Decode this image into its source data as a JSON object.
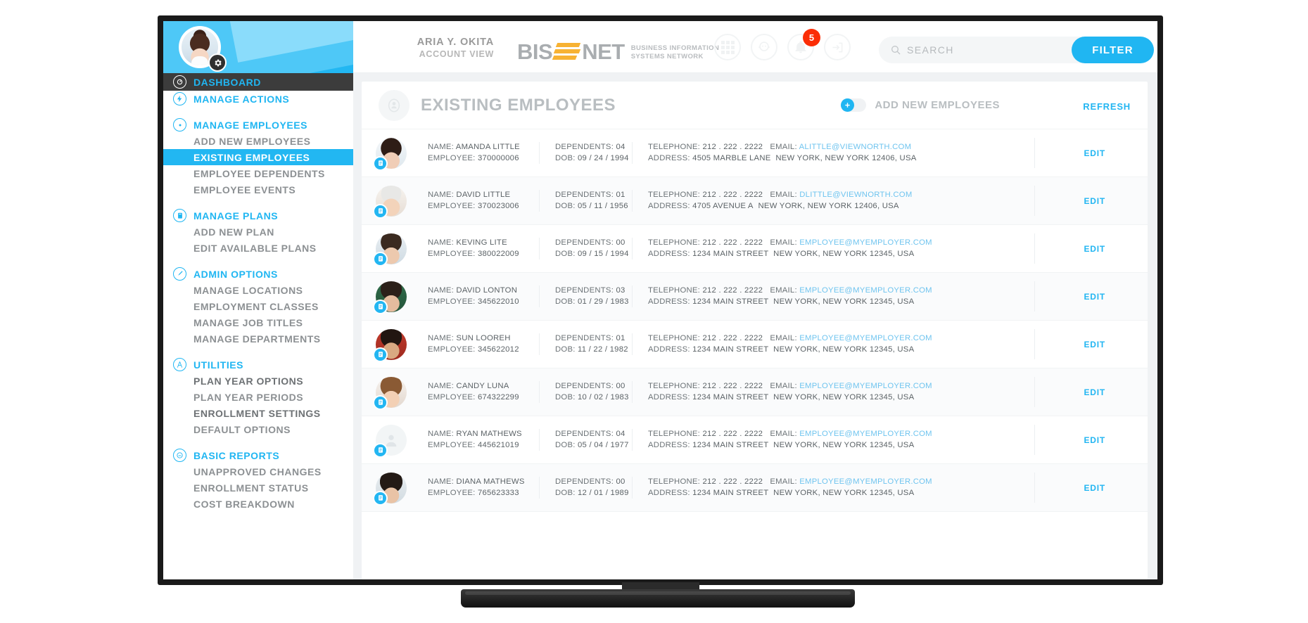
{
  "header": {
    "account_name": "ARIA Y. OKITA",
    "account_sub": "ACCOUNT VIEW",
    "avatar_name": "user-avatar",
    "gear_icon": "gear-icon",
    "logo_part1": "BIS",
    "logo_part2": "NET",
    "logo_sub_line1": "BUSINESS INFORMATION",
    "logo_sub_line2": "SYSTEMS NETWORK",
    "icons": [
      {
        "name": "apps-grid-icon",
        "label": ""
      },
      {
        "name": "support-agent-icon",
        "label": ""
      },
      {
        "name": "notifications-bell-icon",
        "label": ""
      },
      {
        "name": "logout-icon",
        "label": ""
      }
    ],
    "notification_count": "5",
    "search_placeholder": "SEARCH",
    "search_value": "",
    "filter_label": "FILTER",
    "accent_color": "#20b6f2",
    "badge_color": "#fb2d06",
    "logo_mark_color": "#f7b233"
  },
  "sidebar": {
    "items": [
      {
        "label": "DASHBOARD",
        "type": "dashboard",
        "icon": "dashboard-icon"
      },
      {
        "label": "MANAGE ACTIONS",
        "type": "group",
        "icon": "bolt-icon"
      },
      {
        "type": "gap"
      },
      {
        "label": "MANAGE EMPLOYEES",
        "type": "group",
        "icon": "employees-icon"
      },
      {
        "label": "ADD NEW EMPLOYEES",
        "type": "sub"
      },
      {
        "label": "EXISTING EMPLOYEES",
        "type": "sub",
        "active": true
      },
      {
        "label": "EMPLOYEE DEPENDENTS",
        "type": "sub"
      },
      {
        "label": "EMPLOYEE EVENTS",
        "type": "sub"
      },
      {
        "type": "gap"
      },
      {
        "label": "MANAGE PLANS",
        "type": "group",
        "icon": "clipboard-icon"
      },
      {
        "label": "ADD NEW PLAN",
        "type": "sub"
      },
      {
        "label": "EDIT AVAILABLE PLANS",
        "type": "sub"
      },
      {
        "type": "gap"
      },
      {
        "label": "ADMIN OPTIONS",
        "type": "group",
        "icon": "admin-key-icon"
      },
      {
        "label": "MANAGE LOCATIONS",
        "type": "sub"
      },
      {
        "label": "EMPLOYMENT CLASSES",
        "type": "sub"
      },
      {
        "label": "MANAGE JOB TITLES",
        "type": "sub"
      },
      {
        "label": "MANAGE DEPARTMENTS",
        "type": "sub"
      },
      {
        "type": "gap"
      },
      {
        "label": "UTILITIES",
        "type": "group",
        "icon": "utilities-icon"
      },
      {
        "label": "PLAN YEAR OPTIONS",
        "type": "sub",
        "dark": true
      },
      {
        "label": "PLAN YEAR PERIODS",
        "type": "sub"
      },
      {
        "label": "ENROLLMENT SETTINGS",
        "type": "sub",
        "dark": true
      },
      {
        "label": "DEFAULT OPTIONS",
        "type": "sub"
      },
      {
        "type": "gap"
      },
      {
        "label": "BASIC REPORTS",
        "type": "group",
        "icon": "reports-icon"
      },
      {
        "label": "UNAPPROVED CHANGES",
        "type": "sub"
      },
      {
        "label": "ENROLLMENT STATUS",
        "type": "sub"
      },
      {
        "label": "COST BREAKDOWN",
        "type": "sub"
      }
    ]
  },
  "main": {
    "page_icon": "person-circle-icon",
    "page_title": "EXISTING EMPLOYEES",
    "add_toggle_label": "ADD NEW EMPLOYEES",
    "add_toggle_icon": "add-person-icon",
    "refresh_label": "REFRESH",
    "edit_label": "EDIT",
    "labels": {
      "name": "NAME:",
      "employee": "EMPLOYEE:",
      "dependents": "DEPENDENTS:",
      "dob": "DOB:",
      "telephone": "TELEPHONE:",
      "email": "EMAIL:",
      "address": "ADDRESS:"
    },
    "employees": [
      {
        "name": "AMANDA LITTLE",
        "employee_id": "370000006",
        "dependents": "04",
        "dob": "09 / 24 / 1994",
        "telephone": "212 . 222 . 2222",
        "email": "ALITTLE@VIEWNORTH.COM",
        "address_street": "4505 MARBLE LANE",
        "address_city": "NEW YORK, NEW YORK 12406, USA",
        "avatar": "photo-female-dark-hair"
      },
      {
        "name": "DAVID LITTLE",
        "employee_id": "370023006",
        "dependents": "01",
        "dob": "05 / 11 / 1956",
        "telephone": "212 . 222 . 2222",
        "email": "DLITTLE@VIEWNORTH.COM",
        "address_street": "4705 AVENUE A",
        "address_city": "NEW YORK, NEW YORK 12406, USA",
        "avatar": "photo-senior-male"
      },
      {
        "name": "KEVING LITE",
        "employee_id": "380022009",
        "dependents": "00",
        "dob": "09 / 15 / 1994",
        "telephone": "212 . 222 . 2222",
        "email": "EMPLOYEE@MYEMPLOYER.COM",
        "address_street": "1234 MAIN STREET",
        "address_city": "NEW YORK, NEW YORK 12345, USA",
        "avatar": "photo-young-male"
      },
      {
        "name": "DAVID LONTON",
        "employee_id": "345622010",
        "dependents": "03",
        "dob": "01 / 29 / 1983",
        "telephone": "212 . 222 . 2222",
        "email": "EMPLOYEE@MYEMPLOYER.COM",
        "address_street": "1234 MAIN STREET",
        "address_city": "NEW YORK, NEW YORK 12345, USA",
        "avatar": "photo-bearded-male"
      },
      {
        "name": "SUN LOOREH",
        "employee_id": "345622012",
        "dependents": "01",
        "dob": "11 / 22 / 1982",
        "telephone": "212 . 222 . 2222",
        "email": "EMPLOYEE@MYEMPLOYER.COM",
        "address_street": "1234 MAIN STREET",
        "address_city": "NEW YORK, NEW YORK 12345, USA",
        "avatar": "photo-male-red-bg"
      },
      {
        "name": "CANDY LUNA",
        "employee_id": "674322299",
        "dependents": "00",
        "dob": "10 / 02 / 1983",
        "telephone": "212 . 222 . 2222",
        "email": "EMPLOYEE@MYEMPLOYER.COM",
        "address_street": "1234 MAIN STREET",
        "address_city": "NEW YORK, NEW YORK 12345, USA",
        "avatar": "photo-female-smiling"
      },
      {
        "name": "RYAN MATHEWS",
        "employee_id": "445621019",
        "dependents": "04",
        "dob": "05 / 04 / 1977",
        "telephone": "212 . 222 . 2222",
        "email": "EMPLOYEE@MYEMPLOYER.COM",
        "address_street": "1234 MAIN STREET",
        "address_city": "NEW YORK, NEW YORK 12345, USA",
        "avatar": "placeholder-person"
      },
      {
        "name": "DIANA MATHEWS",
        "employee_id": "765623333",
        "dependents": "00",
        "dob": "12 / 01 / 1989",
        "telephone": "212 . 222 . 2222",
        "email": "EMPLOYEE@MYEMPLOYER.COM",
        "address_street": "1234 MAIN STREET",
        "address_city": "NEW YORK, NEW YORK 12345, USA",
        "avatar": "photo-female-dark"
      }
    ]
  }
}
